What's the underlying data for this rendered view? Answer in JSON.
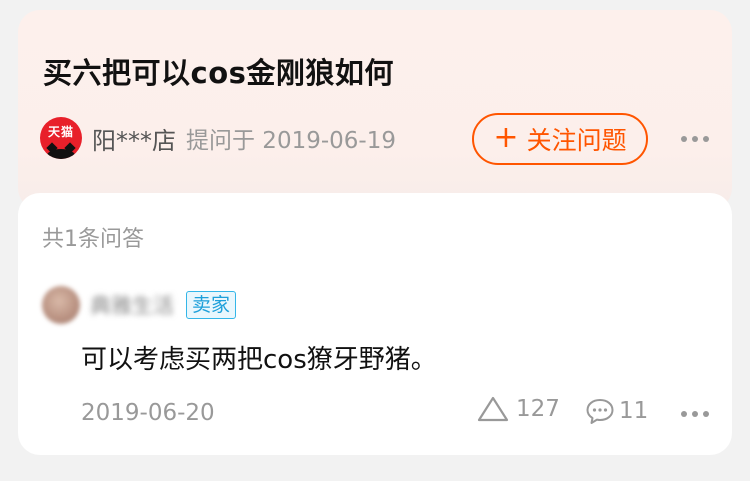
{
  "question": {
    "title": "买六把可以cos金刚狼如何",
    "asker_avatar_text": "天猫",
    "asker_name": "阳***店",
    "asked_meta": "提问于 2019-06-19",
    "follow_plus": "+",
    "follow_label": "关注问题"
  },
  "answers": {
    "count_label": "共1条问答",
    "items": [
      {
        "user_name": "典雅生活",
        "badge": "卖家",
        "text": "可以考虑买两把cos獠牙野猪。",
        "date": "2019-06-20",
        "likes": "127",
        "comments": "11"
      }
    ]
  },
  "colors": {
    "accent": "#ff5500",
    "badge_blue": "#1ea0da",
    "tmall_red": "#e8202a"
  },
  "icons": [
    "tmall-logo-icon",
    "plus-icon",
    "more-icon",
    "like-triangle-icon",
    "comment-icon"
  ]
}
